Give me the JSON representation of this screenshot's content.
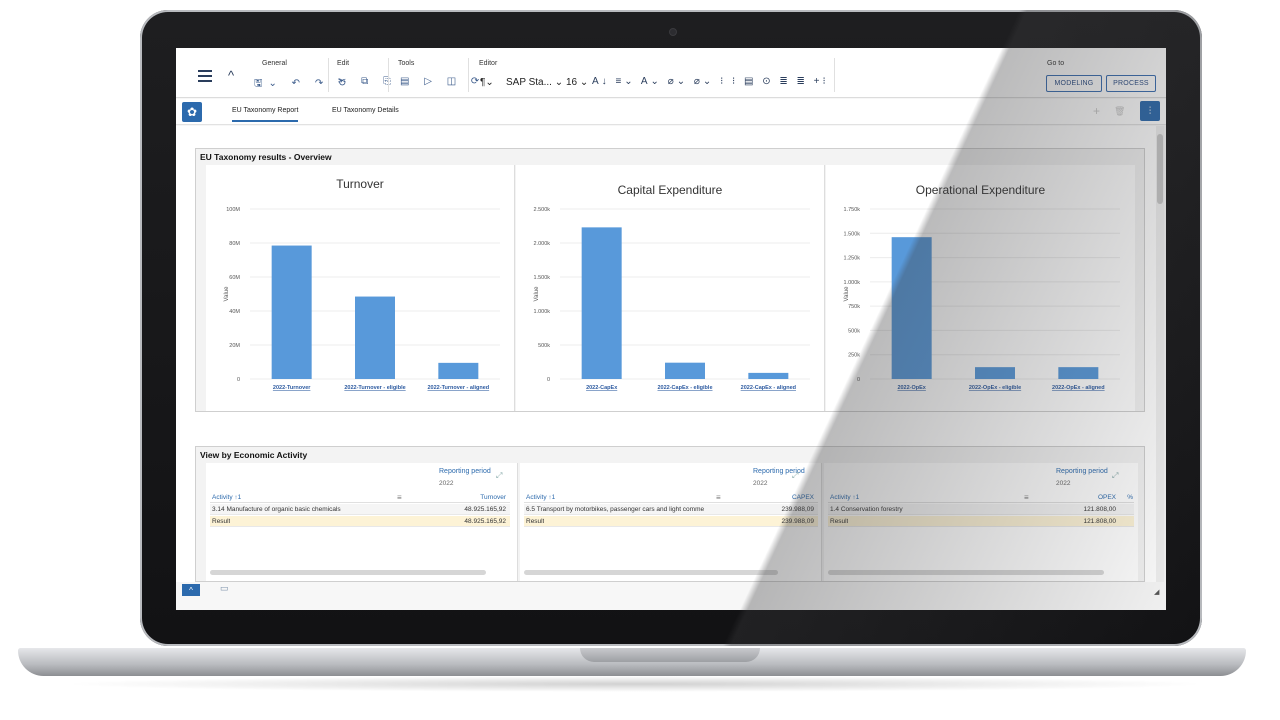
{
  "toolbar": {
    "groups": {
      "general": "General",
      "edit": "Edit",
      "tools": "Tools",
      "editor": "Editor",
      "goto": "Go to"
    },
    "general_icons": "🖫⌄ ↶ ↷ ↻",
    "edit_icons": "✂ ⧉ ⎘",
    "tools_icons": "▤ ▷ ◫ ⟳",
    "editor_para": "¶⌄",
    "font_name": "SAP Sta...",
    "font_size": "16",
    "editor_icons": "A↓ ≡⌄ A⌄ ⌀⌄ ⌀⌄ ⁝ ⁝ ▤ ⊙ ≣ ≣ +⁝",
    "modeling_label": "MODELING",
    "process_label": "PROCESS"
  },
  "tabs": {
    "report": "EU Taxonomy Report",
    "details": "EU Taxonomy Details"
  },
  "overview": {
    "title": "EU Taxonomy results - Overview"
  },
  "activity": {
    "title": "View by Economic Activity",
    "reporting_period_label": "Reporting period",
    "year": "2022",
    "activity_header": "Activity ↑1",
    "tables": [
      {
        "measure": "Turnover",
        "row_label": "3.14 Manufacture of organic basic chemicals",
        "row_value": "48.925.165,92",
        "result_label": "Result",
        "result_value": "48.925.165,92"
      },
      {
        "measure": "CAPEX",
        "row_label": "6.5 Transport by motorbikes, passenger cars and light comme",
        "row_value": "239.988,09",
        "result_label": "Result",
        "result_value": "239.988,09"
      },
      {
        "measure": "OPEX",
        "row_label": "1.4 Conservation forestry",
        "row_value": "121.808,00",
        "result_label": "Result",
        "result_value": "121.808,00",
        "extra": "%"
      }
    ]
  },
  "chart_data": [
    {
      "type": "bar",
      "title": "Turnover",
      "ylabel": "Value",
      "categories": [
        "2022-Turnover",
        "2022-Turnover - eligible",
        "2022-Turnover - aligned"
      ],
      "values": [
        78500000,
        48500000,
        9500000
      ],
      "ylim": [
        0,
        100000000
      ],
      "ticks": [
        0,
        20000000,
        40000000,
        60000000,
        80000000,
        100000000
      ],
      "tick_labels": [
        "0",
        "20M",
        "40M",
        "60M",
        "80M",
        "100M"
      ],
      "grid": true,
      "color": "#5899da"
    },
    {
      "type": "bar",
      "title": "Capital Expenditure",
      "ylabel": "Value",
      "categories": [
        "2022-CapEx",
        "2022-CapEx - eligible",
        "2022-CapEx - aligned"
      ],
      "values": [
        2230000,
        240000,
        90000
      ],
      "ylim": [
        0,
        2500000
      ],
      "ticks": [
        0,
        500000,
        1000000,
        1500000,
        2000000,
        2500000
      ],
      "tick_labels": [
        "0",
        "500k",
        "1.000k",
        "1.500k",
        "2.000k",
        "2.500k"
      ],
      "grid": true,
      "color": "#5899da"
    },
    {
      "type": "bar",
      "title": "Operational Expenditure",
      "ylabel": "Value",
      "categories": [
        "2022-OpEx",
        "2022-OpEx - eligible",
        "2022-OpEx - aligned"
      ],
      "values": [
        1460000,
        122000,
        122000
      ],
      "ylim": [
        0,
        1750000
      ],
      "ticks": [
        0,
        250000,
        500000,
        750000,
        1000000,
        1250000,
        1500000,
        1750000
      ],
      "tick_labels": [
        "0",
        "250k",
        "500k",
        "750k",
        "1.000k",
        "1.250k",
        "1.500k",
        "1.750k"
      ],
      "grid": true,
      "color": "#5899da"
    }
  ],
  "colors": {
    "accent": "#2c6aad",
    "bar": "#5899da",
    "result_row": "#fdf3d6"
  }
}
